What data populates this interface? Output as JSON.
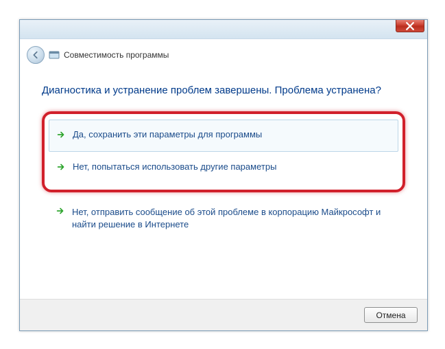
{
  "window": {
    "title": "Совместимость программы"
  },
  "heading": "Диагностика и устранение проблем завершены. Проблема устранена?",
  "options": {
    "yes_save": "Да, сохранить эти параметры для программы",
    "no_retry": "Нет, попытаться использовать другие параметры",
    "no_report": "Нет, отправить сообщение об этой проблеме в корпорацию Майкрософт и найти решение в Интернете"
  },
  "buttons": {
    "cancel": "Отмена"
  }
}
